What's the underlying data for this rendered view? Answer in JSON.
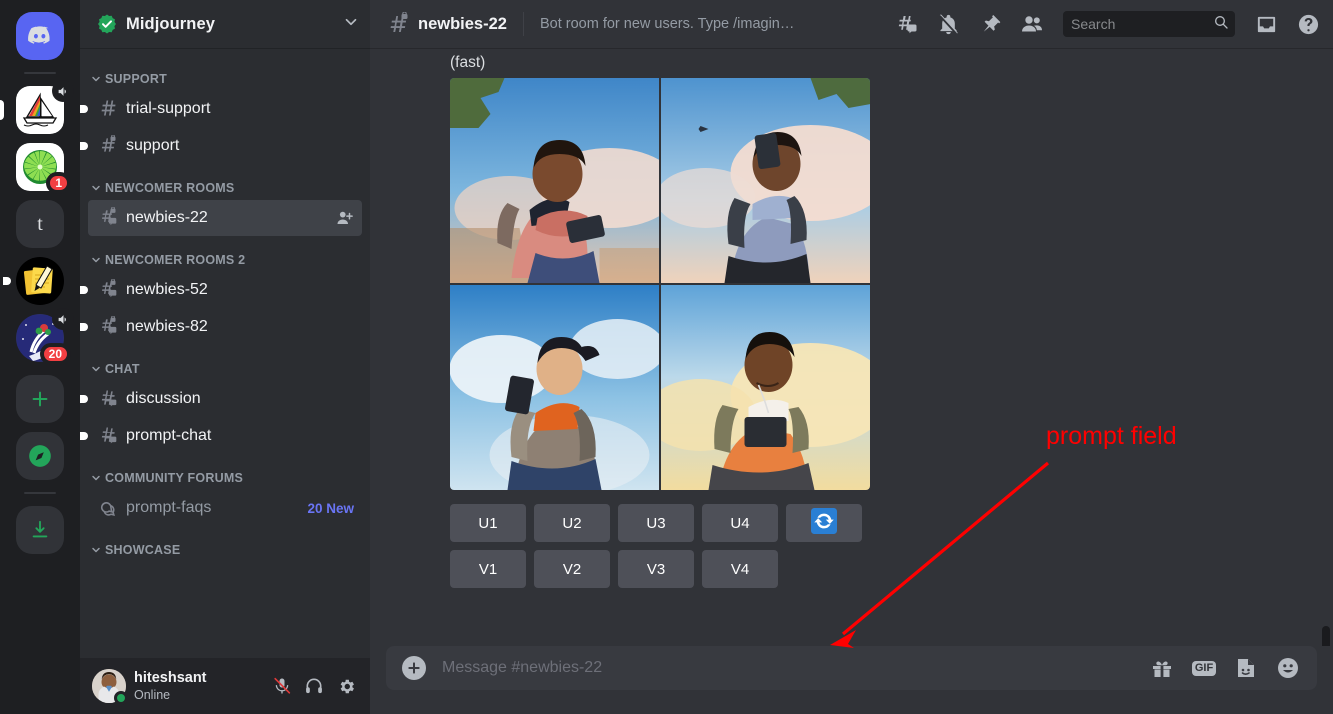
{
  "server_rail": {
    "items": [
      {
        "name": "home-discord",
        "label": "",
        "icon": "discord-logo",
        "badge": "",
        "muted_speaker": false,
        "unread": false
      },
      {
        "name": "midjourney-server",
        "label": "",
        "icon": "sailboat",
        "badge": "",
        "muted_speaker": true,
        "unread": false
      },
      {
        "name": "citrus-server",
        "label": "",
        "icon": "citrus-wheel",
        "badge": "1",
        "muted_speaker": false,
        "unread": false
      },
      {
        "name": "t-server",
        "label": "t",
        "icon": "letter-t",
        "badge": "",
        "muted_speaker": false,
        "unread": false
      },
      {
        "name": "notes-server",
        "label": "",
        "icon": "yellow-notes",
        "badge": "",
        "muted_speaker": false,
        "unread": true
      },
      {
        "name": "flowers-server",
        "label": "",
        "icon": "flowers-night",
        "badge": "20",
        "muted_speaker": true,
        "unread": false
      }
    ],
    "add_server_label": "+",
    "explore_label": "compass",
    "download_label": "download"
  },
  "sidebar": {
    "server_name": "Midjourney",
    "verified": true,
    "categories": [
      {
        "label": "SUPPORT",
        "channels": [
          {
            "label": "trial-support",
            "type": "text",
            "unread": true,
            "private": false,
            "active": false,
            "badge": ""
          },
          {
            "label": "support",
            "type": "text-lock",
            "unread": true,
            "private": true,
            "active": false,
            "badge": ""
          }
        ]
      },
      {
        "label": "NEWCOMER ROOMS",
        "channels": [
          {
            "label": "newbies-22",
            "type": "thread-lock",
            "unread": false,
            "private": true,
            "active": true,
            "badge": ""
          }
        ]
      },
      {
        "label": "NEWCOMER ROOMS 2",
        "channels": [
          {
            "label": "newbies-52",
            "type": "thread-lock",
            "unread": true,
            "private": true,
            "active": false,
            "badge": ""
          },
          {
            "label": "newbies-82",
            "type": "thread-lock",
            "unread": true,
            "private": true,
            "active": false,
            "badge": ""
          }
        ]
      },
      {
        "label": "CHAT",
        "channels": [
          {
            "label": "discussion",
            "type": "thread",
            "unread": true,
            "private": false,
            "active": false,
            "badge": ""
          },
          {
            "label": "prompt-chat",
            "type": "thread",
            "unread": true,
            "private": false,
            "active": false,
            "badge": ""
          }
        ]
      },
      {
        "label": "COMMUNITY FORUMS",
        "channels": [
          {
            "label": "prompt-faqs",
            "type": "forum",
            "unread": false,
            "private": false,
            "active": false,
            "badge": "20 New"
          }
        ]
      },
      {
        "label": "SHOWCASE",
        "channels": []
      }
    ]
  },
  "user_panel": {
    "username": "hiteshsant",
    "status": "Online",
    "mic_muted": true,
    "icons": [
      "microphone-muted-icon",
      "headphones-icon",
      "gear-icon"
    ]
  },
  "topbar": {
    "channel_name": "newbies-22",
    "channel_icon": "hash-lock-icon",
    "topic": "Bot room for new users. Type /imagin…",
    "icons": [
      "threads-icon",
      "bell-muted-icon",
      "pin-icon",
      "members-icon",
      "inbox-icon",
      "help-icon"
    ]
  },
  "search": {
    "placeholder": "Search",
    "value": ""
  },
  "message": {
    "status_text": "(fast)",
    "grid_alt": "Midjourney 2x2 image grid of illustrated young people looking at smartphones under a cloudy blue sky",
    "upscale_buttons": [
      "U1",
      "U2",
      "U3",
      "U4"
    ],
    "reroll_icon": "refresh-icon",
    "variation_buttons": [
      "V1",
      "V2",
      "V3",
      "V4"
    ]
  },
  "composer": {
    "placeholder": "Message #newbies-22",
    "plus_label": "+",
    "gif_label": "GIF",
    "icons": [
      "gift-icon",
      "gif-icon",
      "sticker-icon",
      "emoji-icon"
    ]
  },
  "annotations": [
    {
      "text": "prompt field",
      "color": "#ff0000",
      "points_to": "message-input"
    }
  ],
  "colors": {
    "rail_bg": "#1e1f22",
    "sidebar_bg": "#2b2d31",
    "main_bg": "#313338",
    "accent_blurple": "#5865f2",
    "new_badge": "#6a75f5",
    "online_green": "#23a55a",
    "danger_red": "#f23f42",
    "mj_button": "#4e5058",
    "reroll_blue": "#2a7fd4",
    "annotation_red": "#ff0000"
  }
}
